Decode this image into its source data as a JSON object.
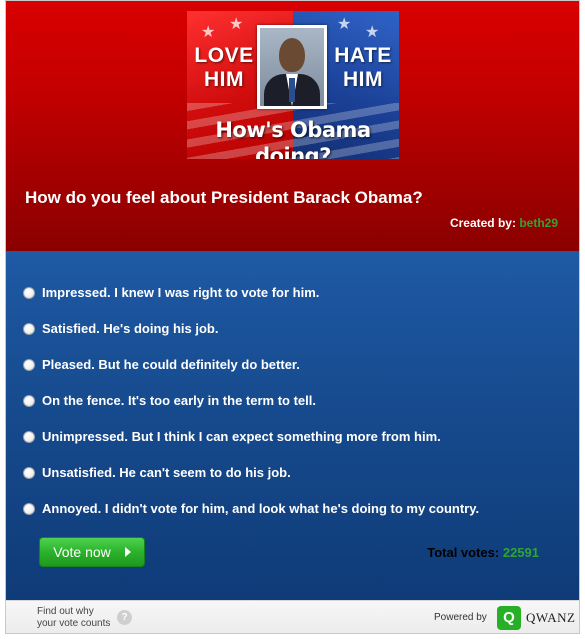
{
  "banner": {
    "left_words": [
      "LOVE",
      "HIM"
    ],
    "right_words": [
      "HATE",
      "HIM"
    ],
    "tagline": "How's Obama doing?"
  },
  "poll": {
    "question": "How do you feel about President Barack Obama?",
    "created_by_label": "Created by:",
    "creator": "beth29",
    "options": [
      "Impressed. I knew I was right to vote for him.",
      "Satisfied. He's doing his job.",
      "Pleased. But he could definitely do better.",
      "On the fence. It's too early in the term to tell.",
      "Unimpressed. But I think I can expect something more from him.",
      "Unsatisfied. He can't seem to do his job.",
      "Annoyed. I didn't vote for him, and look what he's doing to my country."
    ],
    "vote_button": "Vote now",
    "total_votes_label": "Total votes:",
    "total_votes": "22591"
  },
  "footer": {
    "why_line1": "Find out why",
    "why_line2": "your vote counts",
    "help_glyph": "?",
    "powered_by": "Powered by",
    "logo_letter": "Q",
    "brand": "QWANZ"
  },
  "colors": {
    "header_red": "#c40000",
    "body_blue": "#174c90",
    "accent_green": "#2fa52f",
    "button_green": "#2bb22b"
  }
}
